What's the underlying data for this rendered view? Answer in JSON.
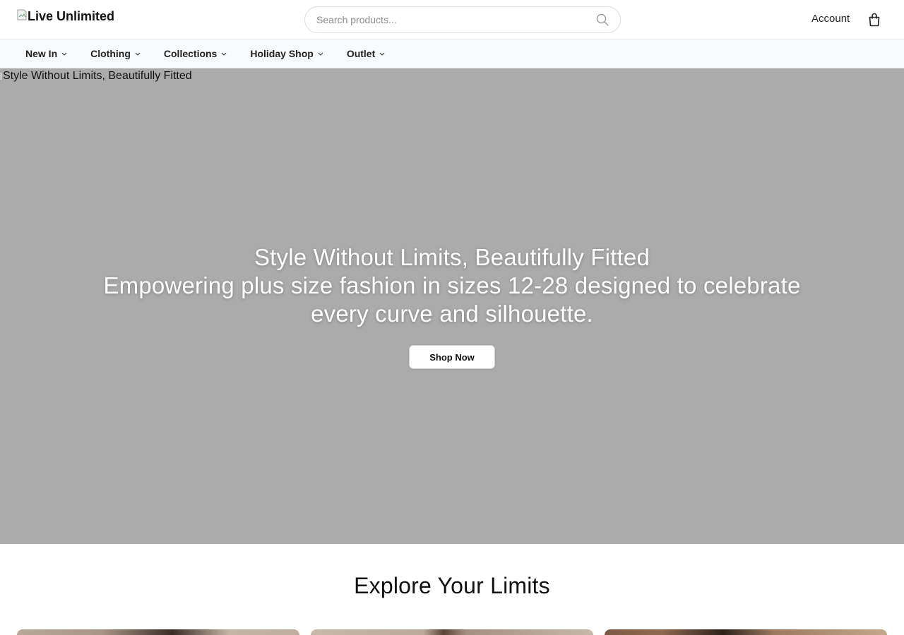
{
  "header": {
    "logo_alt": "Live Unlimited",
    "search": {
      "placeholder": "Search products..."
    },
    "account_label": "Account"
  },
  "nav": {
    "items": [
      {
        "label": "New In"
      },
      {
        "label": "Clothing"
      },
      {
        "label": "Collections"
      },
      {
        "label": "Holiday Shop"
      },
      {
        "label": "Outlet"
      }
    ]
  },
  "hero": {
    "image_alt": "Style Without Limits, Beautifully Fitted",
    "title": "Style Without Limits, Beautifully Fitted",
    "subtitle": "Empowering plus size fashion in sizes 12-28 designed to celebrate every curve and silhouette.",
    "cta_label": "Shop Now",
    "background_color": "#ababab"
  },
  "explore": {
    "title": "Explore Your Limits"
  },
  "icons": {
    "search": "search-icon",
    "bag": "shopping-bag-icon",
    "chevron": "chevron-down-icon"
  }
}
